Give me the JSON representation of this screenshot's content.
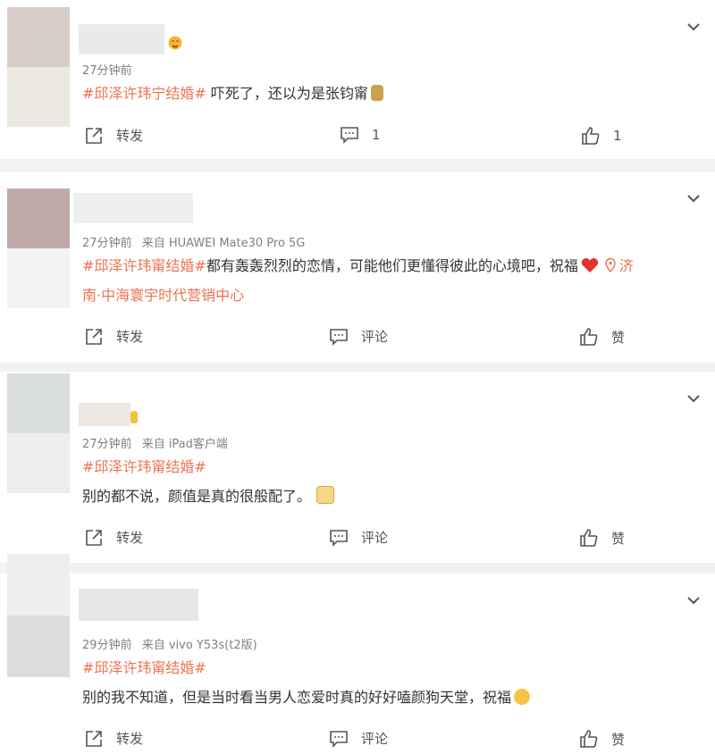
{
  "colors": {
    "topic": "#eb7350",
    "meta": "#808080",
    "text": "#333333",
    "divider": "#f2f2f2"
  },
  "comments": [
    {
      "meta": [
        "27分钟前"
      ],
      "topic": "#邱泽许玮宁结婚#",
      "text": " 吓死了，还以为是张钧甯",
      "forward": "转发",
      "comment": "1",
      "like": "1"
    },
    {
      "meta": [
        "27分钟前",
        "来自 HUAWEI Mate30 Pro 5G"
      ],
      "topic": "#邱泽许玮甯结婚#",
      "text": "都有轰轰烈烈的恋情，可能他们更懂得彼此的心境吧，祝福",
      "location_line1": "济",
      "location_line2": "南·中海寰宇时代营销中心",
      "forward": "转发",
      "comment": "评论",
      "like": "赞"
    },
    {
      "meta": [
        "27分钟前",
        "来自 iPad客户端"
      ],
      "topic": "#邱泽许玮甯结婚#",
      "text": "别的都不说，颜值是真的很般配了。",
      "forward": "转发",
      "comment": "评论",
      "like": "赞"
    },
    {
      "meta": [
        "29分钟前",
        "来自 vivo Y53s(t2版)"
      ],
      "topic": "#邱泽许玮甯结婚#",
      "text": "别的我不知道，但是当时看当男人恋爱时真的好好嗑颜狗天堂，祝福",
      "forward": "转发",
      "comment": "评论",
      "like": "赞"
    }
  ]
}
